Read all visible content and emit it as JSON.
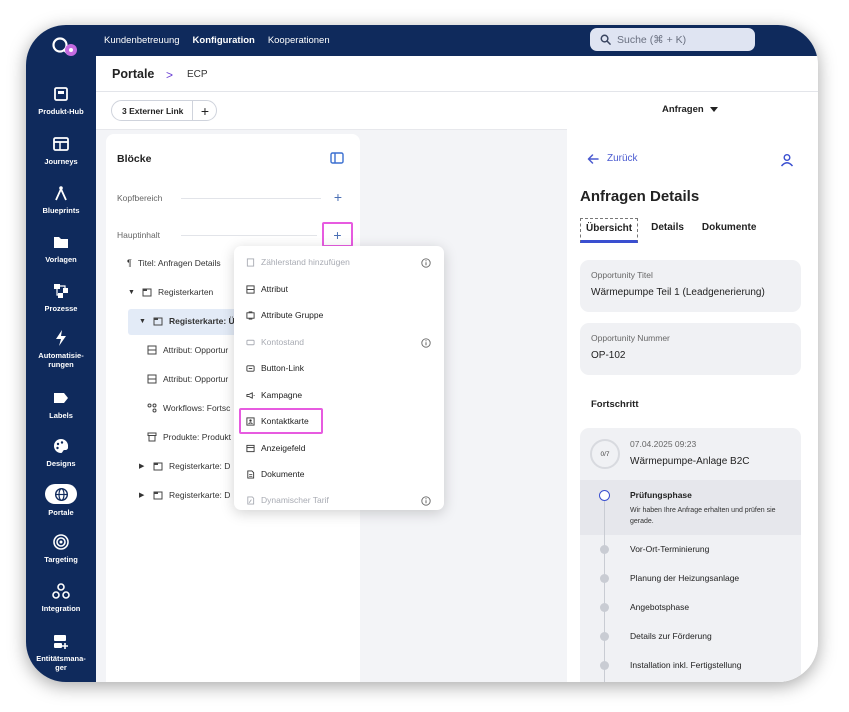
{
  "sidebar": {
    "items": [
      {
        "label": "Produkt-Hub",
        "icon": "product-hub-icon"
      },
      {
        "label": "Journeys",
        "icon": "journeys-icon"
      },
      {
        "label": "Blueprints",
        "icon": "blueprints-icon"
      },
      {
        "label": "Vorlagen",
        "icon": "folder-icon"
      },
      {
        "label": "Prozesse",
        "icon": "process-icon"
      },
      {
        "label": "Automatisie-",
        "label2": "rungen",
        "icon": "lightning-icon"
      },
      {
        "label": "Labels",
        "icon": "label-icon"
      },
      {
        "label": "Designs",
        "icon": "palette-icon"
      },
      {
        "label": "Portale",
        "icon": "globe-icon",
        "active": true
      },
      {
        "label": "Targeting",
        "icon": "target-icon"
      },
      {
        "label": "Integration",
        "icon": "integration-icon"
      },
      {
        "label": "Entitätsmana-",
        "label2": "ger",
        "icon": "entity-manager-icon"
      }
    ]
  },
  "topbar": {
    "nav": [
      "Kundenbetreuung",
      "Konfiguration",
      "Kooperationen"
    ],
    "active": "Konfiguration",
    "search_placeholder": "Suche (⌘ + K)"
  },
  "breadcrumb": {
    "main": "Portale",
    "separator": ">",
    "sub": "ECP"
  },
  "toolbar": {
    "link_button": "3 Externer Link",
    "plus": "+",
    "dropdown": "Anfragen"
  },
  "blocks": {
    "title": "Blöcke",
    "sections": [
      {
        "label": "Kopfbereich"
      },
      {
        "label": "Hauptinhalt"
      }
    ],
    "tree": [
      {
        "label": "Titel: Anfragen Details",
        "icon": "paragraph-icon"
      },
      {
        "label": "Registerkarten",
        "icon": "tab-icon",
        "caret": "▼"
      },
      {
        "label": "Registerkarte: Ü",
        "icon": "tab-icon",
        "caret": "▼",
        "selected": true
      },
      {
        "label": "Attribut: Opportur",
        "icon": "attribute-icon"
      },
      {
        "label": "Attribut: Opportur",
        "icon": "attribute-icon"
      },
      {
        "label": "Workflows: Fortsc",
        "icon": "workflow-icon"
      },
      {
        "label": "Produkte: Produkt",
        "icon": "product-icon"
      },
      {
        "label": "Registerkarte: D",
        "icon": "tab-icon",
        "caret": "▶"
      },
      {
        "label": "Registerkarte: D",
        "icon": "tab-icon",
        "caret": "▶"
      }
    ]
  },
  "menu": {
    "items": [
      {
        "label": "Zählerstand hinzufügen",
        "disabled": true,
        "info": true,
        "icon": "meter-icon"
      },
      {
        "label": "Attribut",
        "icon": "attribute-icon"
      },
      {
        "label": "Attribute Gruppe",
        "icon": "attribute-group-icon"
      },
      {
        "label": "Kontostand",
        "disabled": true,
        "info": true,
        "icon": "balance-icon"
      },
      {
        "label": "Button-Link",
        "icon": "button-link-icon"
      },
      {
        "label": "Kampagne",
        "icon": "megaphone-icon"
      },
      {
        "label": "Kontaktkarte",
        "icon": "contact-card-icon",
        "highlighted": true
      },
      {
        "label": "Anzeigefeld",
        "icon": "display-field-icon"
      },
      {
        "label": "Dokumente",
        "icon": "document-icon"
      },
      {
        "label": "Dynamischer Tarif",
        "disabled": true,
        "info": true,
        "icon": "tariff-icon"
      }
    ]
  },
  "details": {
    "back": "Zurück",
    "title": "Anfragen Details",
    "tabs": [
      "Übersicht",
      "Details",
      "Dokumente"
    ],
    "cards": [
      {
        "key": "Opportunity Titel",
        "value": "Wärmepumpe Teil 1 (Leadgenerierung)"
      },
      {
        "key": "Opportunity Nummer",
        "value": "OP-102"
      }
    ],
    "progress_title": "Fortschritt",
    "progress": {
      "ring": "0/7",
      "date": "07.04.2025 09:23",
      "name": "Wärmepumpe-Anlage B2C",
      "phases": [
        {
          "name": "Prüfungsphase",
          "desc": "Wir haben Ihre Anfrage erhalten und prüfen sie gerade.",
          "active": true
        },
        {
          "name": "Vor-Ort-Terminierung"
        },
        {
          "name": "Planung der Heizungsanlage"
        },
        {
          "name": "Angebotsphase"
        },
        {
          "name": "Details zur Förderung"
        },
        {
          "name": "Installation inkl. Fertigstellung"
        }
      ]
    }
  },
  "colors": {
    "navy": "#0f2a5c",
    "accent": "#3a4fd0",
    "highlight": "#e75be0"
  }
}
